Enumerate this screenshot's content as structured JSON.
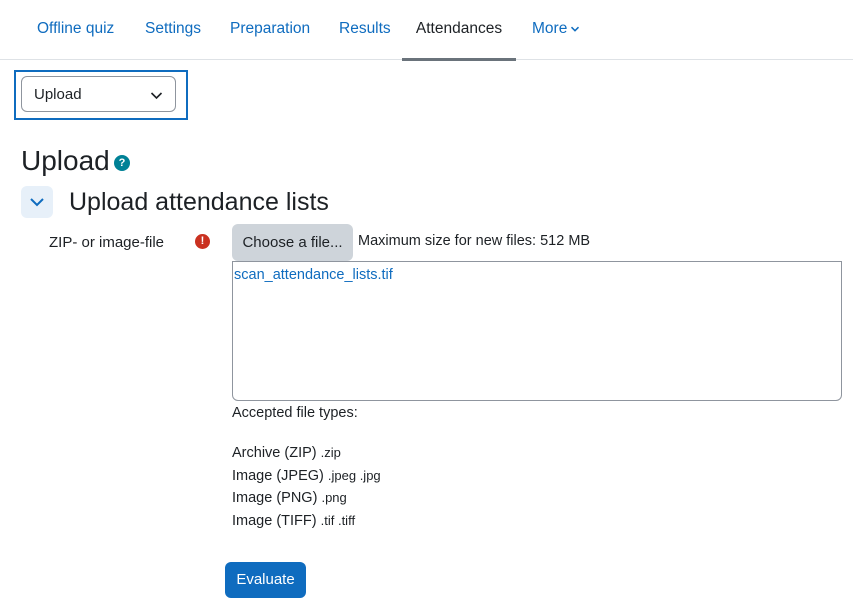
{
  "nav": {
    "tabs": [
      {
        "label": "Offline quiz"
      },
      {
        "label": "Settings"
      },
      {
        "label": "Preparation"
      },
      {
        "label": "Results"
      },
      {
        "label": "Attendances",
        "active": true
      },
      {
        "label": "More"
      }
    ]
  },
  "select": {
    "value": "Upload"
  },
  "page_title": "Upload",
  "help_icon": "?",
  "section": {
    "title": "Upload attendance lists"
  },
  "form": {
    "file_label": "ZIP- or image-file",
    "required_icon": "!",
    "choose_button": "Choose a file...",
    "max_size": "Maximum size for new files: 512 MB",
    "uploaded_file": "scan_attendance_lists.tif",
    "accepted_label": "Accepted file types:",
    "types": [
      {
        "name": "Archive (ZIP)",
        "ext": ".zip"
      },
      {
        "name": "Image (JPEG)",
        "ext": ".jpeg .jpg"
      },
      {
        "name": "Image (PNG)",
        "ext": ".png"
      },
      {
        "name": "Image (TIFF)",
        "ext": ".tif .tiff"
      }
    ],
    "evaluate_button": "Evaluate"
  },
  "colors": {
    "link": "#0f6cbf",
    "primary": "#0f6cbf",
    "help": "#008196",
    "required": "#ca3120"
  }
}
